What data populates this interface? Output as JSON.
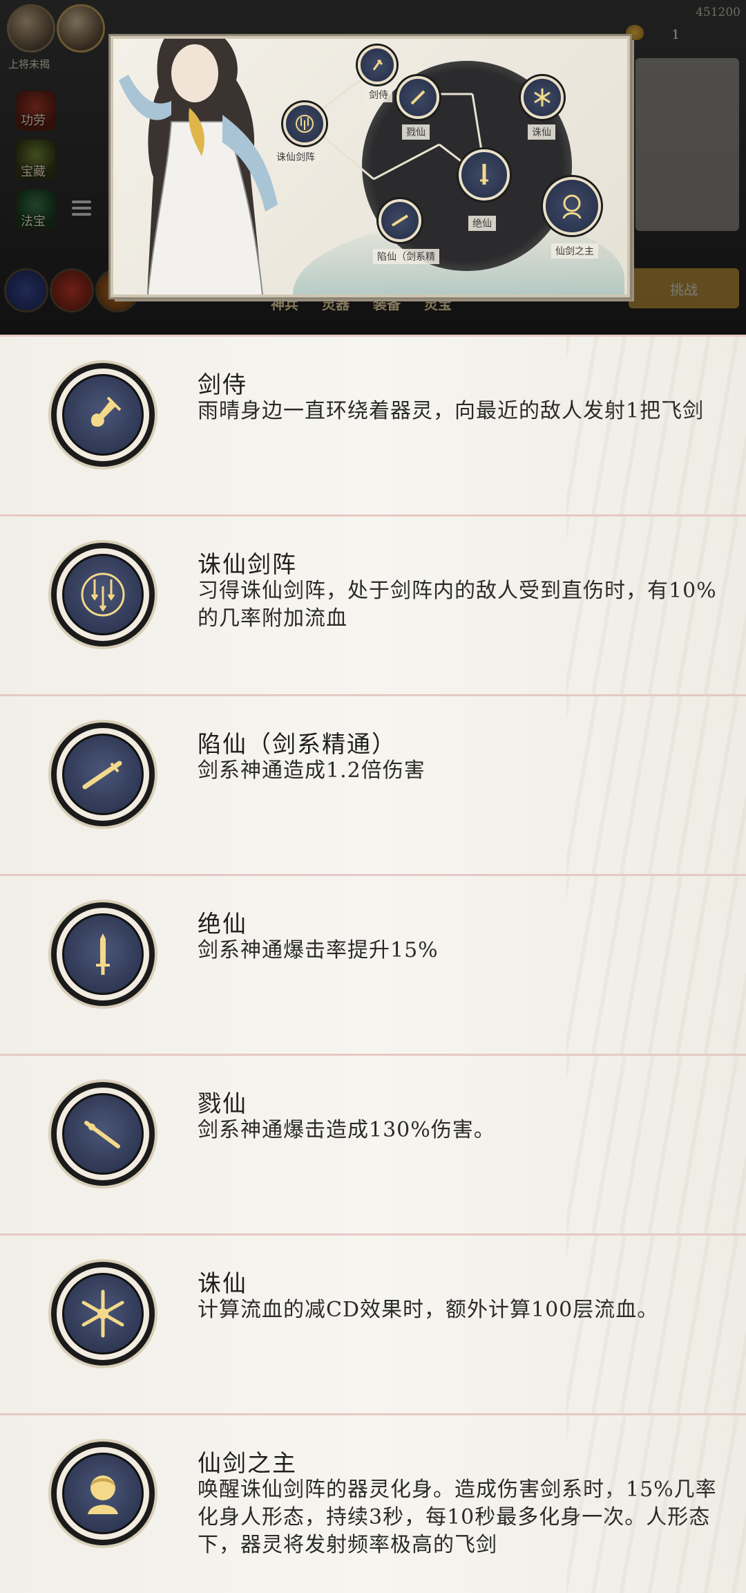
{
  "top_hud": {
    "resource_value": "451200",
    "coin_count": "1",
    "lock_label": "上将未揭",
    "side_labels": [
      "功劳",
      "宝藏",
      "法宝"
    ],
    "bottom_tabs": [
      "神兵",
      "灵器",
      "装备",
      "灵宝"
    ],
    "challenge_button": "挑战",
    "colors": {
      "gold": "#c89c3c",
      "dark": "#2b2b2d"
    }
  },
  "skill_tree": {
    "nodes": [
      {
        "id": "jianshi",
        "label": "剑侍",
        "icon": "sword-hilt-icon"
      },
      {
        "id": "zhuxian_jianzhen",
        "label": "诛仙剑阵",
        "icon": "sword-array-icon"
      },
      {
        "id": "lunxian",
        "label": "戮仙",
        "icon": "sword-diagonal-icon"
      },
      {
        "id": "zhuxian",
        "label": "诛仙",
        "icon": "sword-star-icon"
      },
      {
        "id": "xianxian",
        "label": "陷仙（剑系精",
        "icon": "sword-slash-icon"
      },
      {
        "id": "juexian",
        "label": "绝仙",
        "icon": "sword-vertical-icon"
      },
      {
        "id": "xianjianzhizhu",
        "label": "仙剑之主",
        "icon": "spirit-avatar-icon"
      }
    ]
  },
  "skills": [
    {
      "name": "剑侍",
      "desc": "雨晴身边一直环绕着器灵，向最近的敌人发射1把飞剑",
      "icon": "sword-hilt-icon"
    },
    {
      "name": "诛仙剑阵",
      "desc": "习得诛仙剑阵，处于剑阵内的敌人受到直伤时，有10%的几率附加流血",
      "icon": "sword-array-icon"
    },
    {
      "name": "陷仙（剑系精通）",
      "desc": "剑系神通造成1.2倍伤害",
      "icon": "sword-slash-icon"
    },
    {
      "name": "绝仙",
      "desc": "剑系神通爆击率提升15%",
      "icon": "sword-vertical-icon"
    },
    {
      "name": "戮仙",
      "desc": "剑系神通爆击造成130%伤害。",
      "icon": "sword-diagonal-icon"
    },
    {
      "name": "诛仙",
      "desc": "计算流血的减CD效果时，额外计算100层流血。",
      "icon": "sword-star-icon"
    },
    {
      "name": "仙剑之主",
      "desc": "唤醒诛仙剑阵的器灵化身。造成伤害剑系时，15%几率化身人形态，持续3秒，每10秒最多化身一次。人形态下，器灵将发射频率极高的飞剑",
      "icon": "spirit-avatar-icon"
    }
  ]
}
